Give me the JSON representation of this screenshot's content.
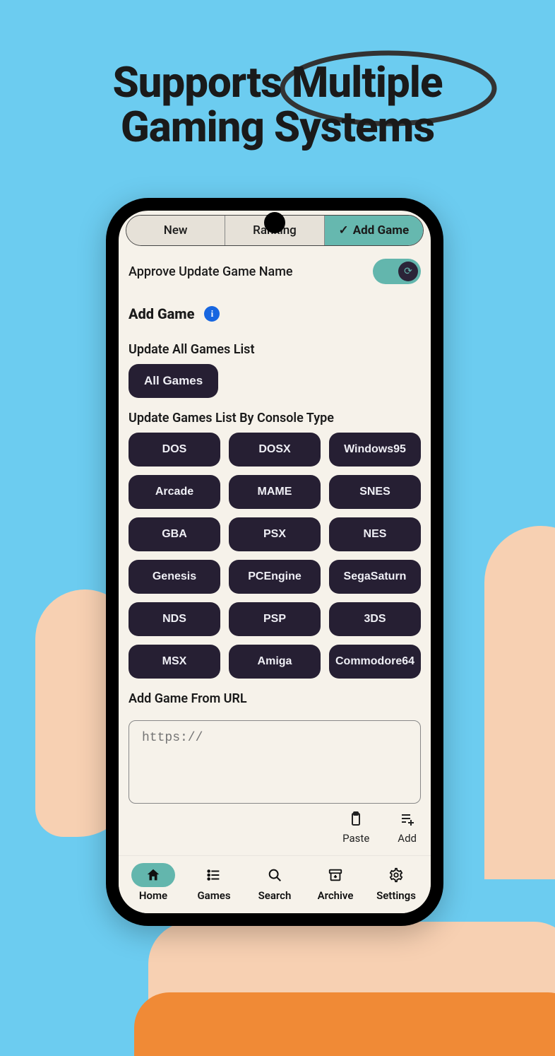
{
  "headline": {
    "line1": "Supports Multiple",
    "line2": "Gaming Systems"
  },
  "tabs": [
    {
      "label": "New",
      "active": false
    },
    {
      "label": "Ranking",
      "active": false
    },
    {
      "label": "Add Game",
      "active": true
    }
  ],
  "approve": {
    "label": "Approve Update Game Name",
    "on": true
  },
  "addGame": {
    "title": "Add Game"
  },
  "updateAll": {
    "header": "Update All Games List",
    "button": "All Games"
  },
  "updateByConsole": {
    "header": "Update Games List By Console Type",
    "items": [
      "DOS",
      "DOSX",
      "Windows95",
      "Arcade",
      "MAME",
      "SNES",
      "GBA",
      "PSX",
      "NES",
      "Genesis",
      "PCEngine",
      "SegaSaturn",
      "NDS",
      "PSP",
      "3DS",
      "MSX",
      "Amiga",
      "Commodore64"
    ]
  },
  "addFromUrl": {
    "header": "Add Game From URL",
    "placeholder": "https://",
    "paste": "Paste",
    "add": "Add"
  },
  "bottomNav": [
    {
      "label": "Home",
      "icon": "home",
      "active": true
    },
    {
      "label": "Games",
      "icon": "list",
      "active": false
    },
    {
      "label": "Search",
      "icon": "search",
      "active": false
    },
    {
      "label": "Archive",
      "icon": "archive",
      "active": false
    },
    {
      "label": "Settings",
      "icon": "settings",
      "active": false
    }
  ]
}
